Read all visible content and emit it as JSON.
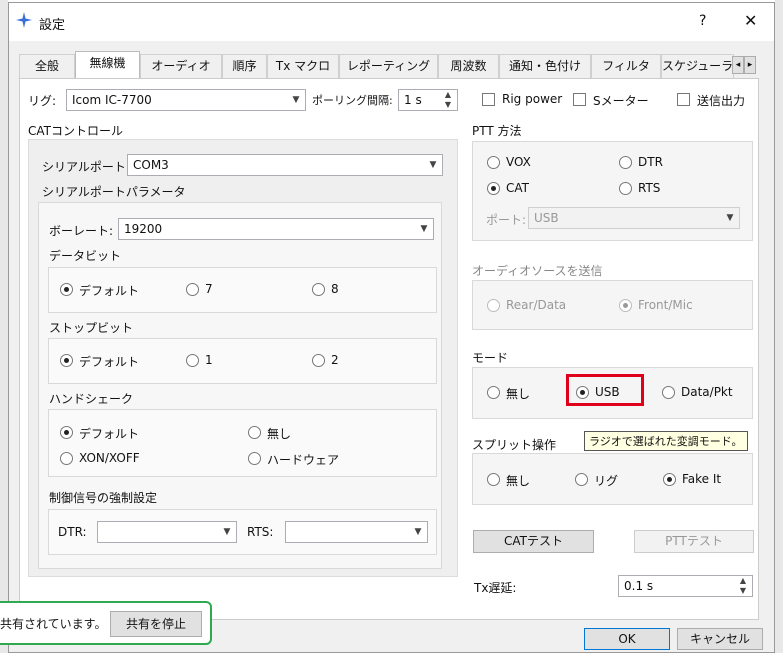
{
  "window": {
    "title": "設定",
    "help": "?",
    "close": "✕"
  },
  "tabs": [
    "全般",
    "無線機",
    "オーディオ",
    "順序",
    "Tx マクロ",
    "レポーティング",
    "周波数",
    "通知・色付け",
    "フィルタ",
    "スケジューラ"
  ],
  "tab_arrows": {
    "left": "◂",
    "right": "▸"
  },
  "rig": {
    "label": "リグ:",
    "value": "Icom IC-7700",
    "poll_label": "ポーリング間隔:",
    "poll_value": "1 s",
    "rig_power": "Rig power",
    "s_meter": "Sメーター",
    "tx_output": "送信出力"
  },
  "cat": {
    "title": "CATコントロール",
    "serial_port_label": "シリアルポート:",
    "serial_port_value": "COM3",
    "serial_params": "シリアルポートパラメータ",
    "baud_label": "ボーレート:",
    "baud_value": "19200",
    "data_bits": {
      "title": "データビット",
      "options": [
        "デフォルト",
        "7",
        "8"
      ]
    },
    "stop_bits": {
      "title": "ストップビット",
      "options": [
        "デフォルト",
        "1",
        "2"
      ]
    },
    "handshake": {
      "title": "ハンドシェーク",
      "options": [
        "デフォルト",
        "無し",
        "XON/XOFF",
        "ハードウェア"
      ]
    },
    "force": {
      "title": "制御信号の強制設定",
      "dtr": "DTR:",
      "rts": "RTS:"
    }
  },
  "ptt": {
    "title": "PTT 方法",
    "options": [
      "VOX",
      "DTR",
      "CAT",
      "RTS"
    ],
    "port_label": "ポート:",
    "port_value": "USB"
  },
  "audio_src": {
    "title": "オーディオソースを送信",
    "options": [
      "Rear/Data",
      "Front/Mic"
    ]
  },
  "mode": {
    "title": "モード",
    "options": [
      "無し",
      "USB",
      "Data/Pkt"
    ]
  },
  "tooltip": "ラジオで選ばれた変調モード。",
  "split": {
    "title": "スプリット操作",
    "options": [
      "無し",
      "リグ",
      "Fake It"
    ]
  },
  "buttons": {
    "cat_test": "CATテスト",
    "ptt_test": "PTTテスト",
    "ok": "OK",
    "cancel": "キャンセル"
  },
  "tx_delay": {
    "label": "Tx遅延:",
    "value": "0.1 s"
  },
  "sharing": {
    "text": "共有されています。",
    "stop": "共有を停止"
  },
  "colors": {
    "highlight": "#e0001b",
    "sharing_border": "#2fa84f",
    "tab_active": "#ffffff"
  }
}
